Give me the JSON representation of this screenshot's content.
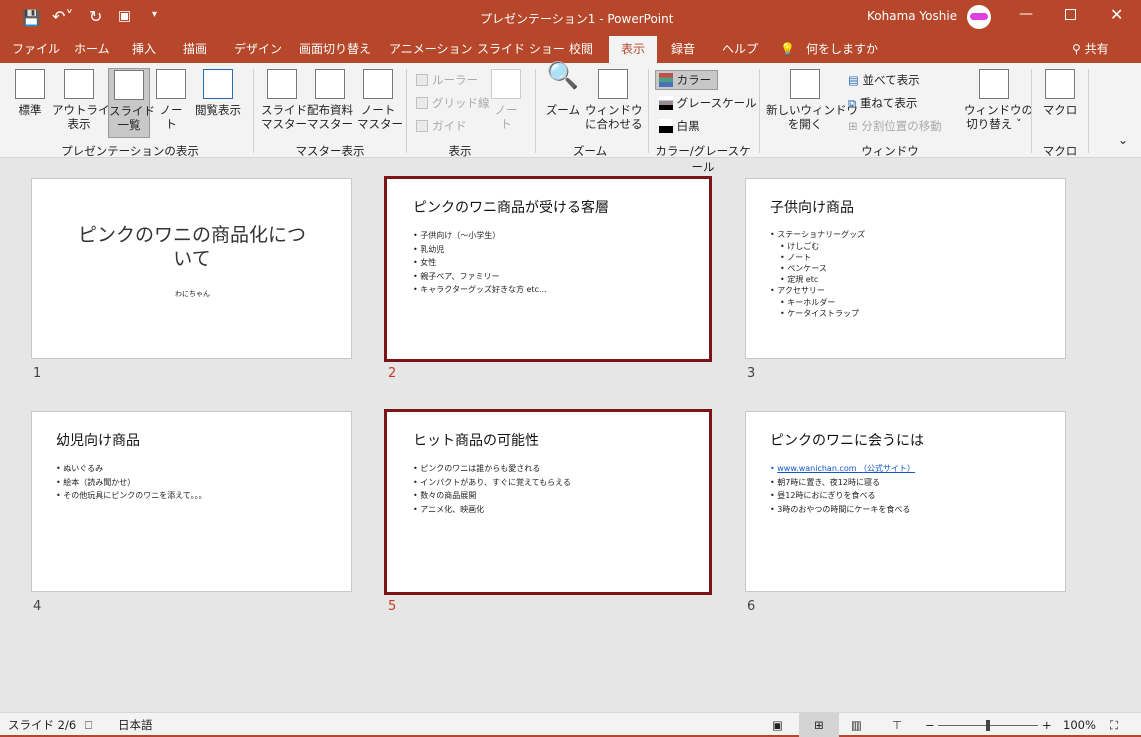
{
  "titlebar": {
    "title": "プレゼンテーション1 - PowerPoint",
    "user": "Kohama Yoshie"
  },
  "tabs": [
    "ファイル",
    "ホーム",
    "挿入",
    "描画",
    "デザイン",
    "画面切り替え",
    "アニメーション",
    "スライド ショー",
    "校閲",
    "表示",
    "録音",
    "ヘルプ"
  ],
  "active_tab": "表示",
  "tell_me": "何をしますか",
  "share": "共有",
  "ribbon": {
    "pres_views": {
      "label": "プレゼンテーションの表示",
      "items": [
        "標準",
        "アウトライン\n表示",
        "スライド\n一覧",
        "ノー\nト",
        "閲覧表示"
      ]
    },
    "master_views": {
      "label": "マスター表示",
      "items": [
        "スライド\nマスター",
        "配布資料\nマスター",
        "ノート\nマスター"
      ]
    },
    "show": {
      "label": "表示",
      "checks": [
        "ルーラー",
        "グリッド線",
        "ガイド"
      ],
      "notes": "ノー\nト"
    },
    "zoom": {
      "label": "ズーム",
      "items": [
        "ズーム",
        "ウィンドウ\nに合わせる"
      ]
    },
    "color": {
      "label": "カラー/グレースケール",
      "items": [
        "カラー",
        "グレースケール",
        "白黒"
      ]
    },
    "window": {
      "label": "ウィンドウ",
      "new": "新しいウィンドウ\nを開く",
      "arrange": "並べて表示",
      "cascade": "重ねて表示",
      "split": "分割位置の移動",
      "switch": "ウィンドウの\n切り替え ˇ"
    },
    "macros": {
      "label": "マクロ",
      "item": "マクロ"
    }
  },
  "slides": [
    {
      "num": "1",
      "title": "ピンクのワニの商品化について",
      "subtitle": "わにちゃん"
    },
    {
      "num": "2",
      "title": "ピンクのワニ商品が受ける客層",
      "bullets": [
        "子供向け（～小学生）",
        "乳幼児",
        "女性",
        "親子ペア、ファミリー",
        "キャラクターグッズ好きな方 etc..."
      ]
    },
    {
      "num": "3",
      "title": "子供向け商品",
      "bullets": [
        "ステーショナリーグッズ",
        "けしごむ",
        "ノート",
        "ペンケース",
        "定規 etc",
        "アクセサリー",
        "キーホルダー",
        "ケータイストラップ"
      ]
    },
    {
      "num": "4",
      "title": "幼児向け商品",
      "bullets": [
        "ぬいぐるみ",
        "絵本（読み聞かせ）",
        "その他玩具にピンクのワニを添えて。。。"
      ]
    },
    {
      "num": "5",
      "title": "ヒット商品の可能性",
      "bullets": [
        "ピンクのワニは誰からも愛される",
        "インパクトがあり、すぐに覚えてもらえる",
        "数々の商品展開",
        "アニメ化、映画化"
      ]
    },
    {
      "num": "6",
      "title": "ピンクのワニに会うには",
      "link": "www.wanichan.com （公式サイト）",
      "bullets": [
        "朝7時に置き、夜12時に寝る",
        "昼12時におにぎりを食べる",
        "3時のおやつの時間にケーキを食べる"
      ]
    }
  ],
  "status": {
    "slide": "スライド 2/6",
    "lang": "日本語",
    "zoom": "100%",
    "zoom_percent": 100
  },
  "colors": {
    "accent": "#b7472a",
    "selected_border": "#7b1518"
  }
}
